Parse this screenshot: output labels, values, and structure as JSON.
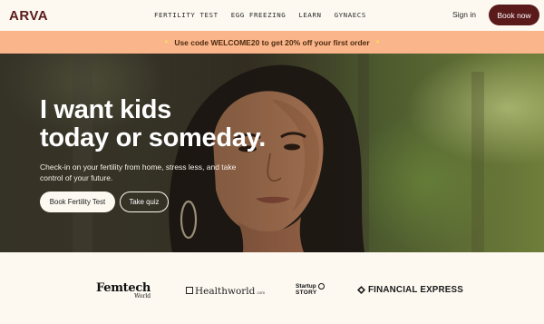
{
  "brand": {
    "logo": "ARVA",
    "color": "#5a1a1a"
  },
  "nav": {
    "items": [
      {
        "label": "FERTILITY TEST"
      },
      {
        "label": "EGG FREEZING"
      },
      {
        "label": "LEARN"
      },
      {
        "label": "GYNAECS"
      }
    ],
    "signin_label": "Sign in",
    "book_now_label": "Book now"
  },
  "promo": {
    "text": "Use code WELCOME20 to get 20% off your first order",
    "spark_icon": "sparkle-icon",
    "background": "#fbb58a"
  },
  "hero": {
    "headline_line1": "I want kids",
    "headline_line2": "today or someday.",
    "subtext": "Check-in on your fertility from home, stress less, and take control of your future.",
    "primary_button": "Book Fertility Test",
    "secondary_button": "Take quiz"
  },
  "press": {
    "femtech": {
      "name": "Femtech",
      "sub": "World"
    },
    "healthworld": {
      "name": "Healthworld",
      "suffix": ".com"
    },
    "startup_story": {
      "line1": "Startup",
      "line2": "STORY"
    },
    "financial_express": {
      "name": "FINANCIAL EXPRESS"
    }
  }
}
